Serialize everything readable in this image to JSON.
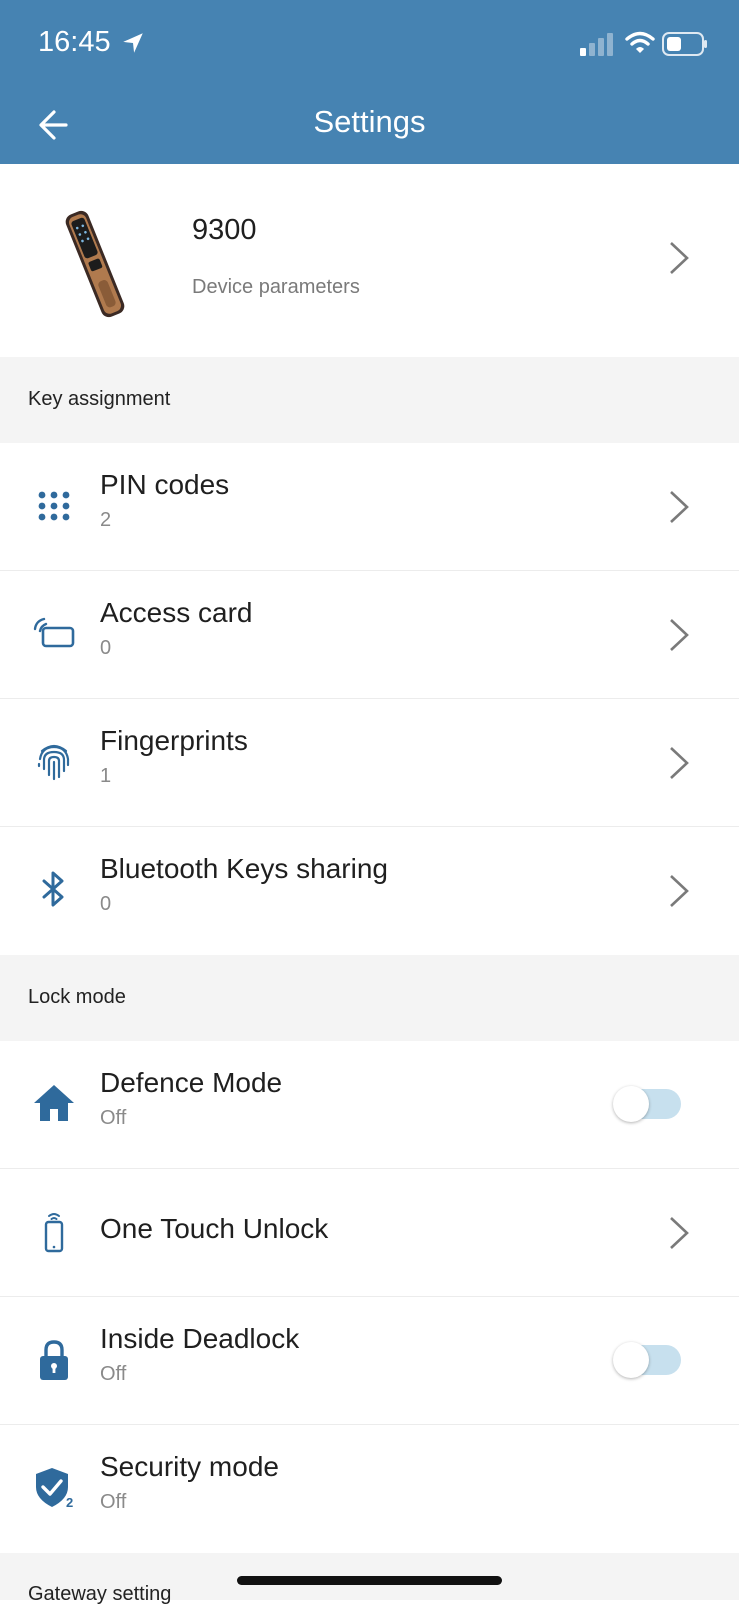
{
  "status_bar": {
    "time": "16:45"
  },
  "header": {
    "title": "Settings"
  },
  "device": {
    "name": "9300",
    "subtitle": "Device parameters"
  },
  "sections": {
    "key_assignment": "Key assignment",
    "lock_mode": "Lock mode",
    "gateway": "Gateway setting"
  },
  "key_items": [
    {
      "label": "PIN codes",
      "count": "2",
      "icon": "keypad-icon"
    },
    {
      "label": "Access card",
      "count": "0",
      "icon": "access-card-icon"
    },
    {
      "label": "Fingerprints",
      "count": "1",
      "icon": "fingerprint-icon"
    },
    {
      "label": "Bluetooth Keys sharing",
      "count": "0",
      "icon": "bluetooth-icon"
    }
  ],
  "lock_items": [
    {
      "label": "Defence Mode",
      "status": "Off",
      "icon": "home-icon",
      "toggle": false
    },
    {
      "label": "One Touch Unlock",
      "icon": "phone-signal-icon"
    },
    {
      "label": "Inside Deadlock",
      "status": "Off",
      "icon": "lock-icon",
      "toggle": false
    },
    {
      "label": "Security mode",
      "status": "Off",
      "icon": "shield-check-icon"
    }
  ],
  "colors": {
    "header_bg": "#4683b2",
    "icon_blue": "#2f6a9c",
    "section_bg": "#f4f4f4",
    "toggle_track": "#c7e0ee"
  }
}
